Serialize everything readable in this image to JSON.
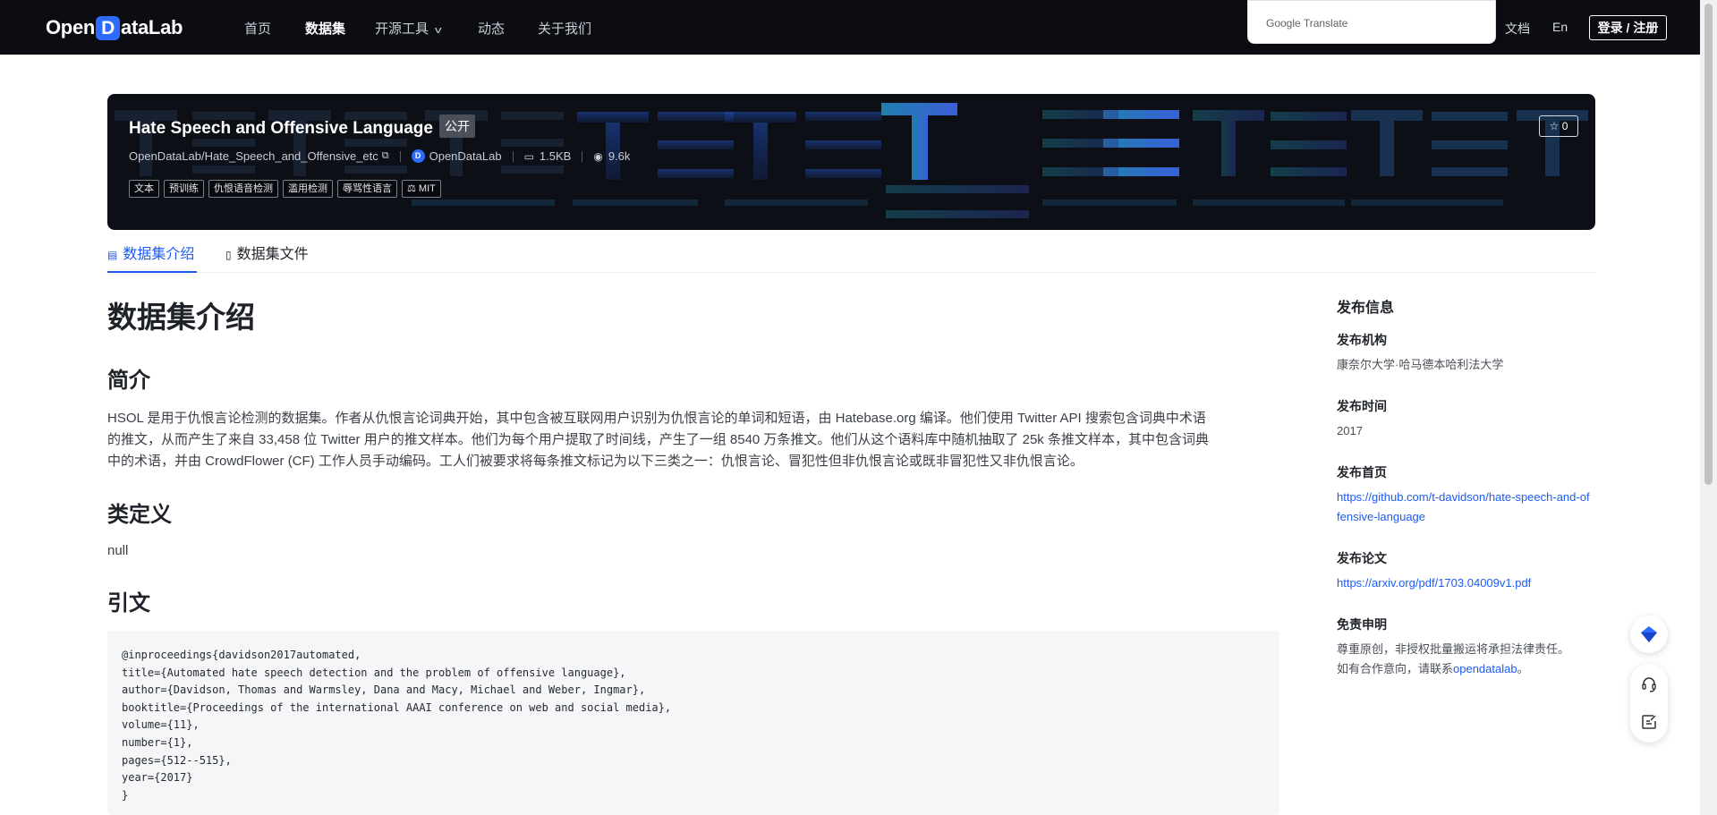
{
  "navbar": {
    "logo_left": "Open",
    "logo_mark": "D",
    "logo_right": "ataLab",
    "items": [
      "首页",
      "数据集",
      "开源工具",
      "动态",
      "关于我们"
    ],
    "google_translate": "Google Translate",
    "docs": "文档",
    "lang": "En",
    "login": "登录 / 注册"
  },
  "hero": {
    "title": "Hate Speech and Offensive Language",
    "visibility": "公开",
    "repo": "OpenDataLab/Hate_Speech_and_Offensive_etc",
    "org": "OpenDataLab",
    "size": "1.5KB",
    "views": "9.6k",
    "tags": [
      "文本",
      "预训练",
      "仇恨语音检测",
      "滥用检测",
      "辱骂性语言"
    ],
    "license": "MIT",
    "stars": "0"
  },
  "tabs": [
    "数据集介绍",
    "数据集文件"
  ],
  "content": {
    "h1": "数据集介绍",
    "intro_heading": "简介",
    "intro_lines": [
      "HSOL 是用于仇恨言论检测的数据集。作者从仇恨言论词典开始，其中包含被互联网用户识别为仇恨言论的单词和短语，由 Hatebase.org 编译。他们使用 Twitter API 搜索包含词典中术语",
      "的推文，从而产生了来自 33,458 位 Twitter 用户的推文样本。他们为每个用户提取了时间线，产生了一组 8540 万条推文。他们从这个语料库中随机抽取了 25k 条推文样本，其中包含词典",
      "中的术语，并由 CrowdFlower (CF) 工作人员手动编码。工人们被要求将每条推文标记为以下三类之一：仇恨言论、冒犯性但非仇恨言论或既非冒犯性又非仇恨言论。"
    ],
    "class_heading": "类定义",
    "class_value": "null",
    "citation_heading": "引文",
    "citation": [
      "@inproceedings{davidson2017automated,",
      "title={Automated hate speech detection and the problem of offensive language},",
      "author={Davidson, Thomas and Warmsley, Dana and Macy, Michael and Weber, Ingmar},",
      "booktitle={Proceedings of the international AAAI conference on web and social media},",
      "volume={11},",
      "number={1},",
      "pages={512--515},",
      "year={2017}",
      "}"
    ]
  },
  "sidebar": {
    "title": "发布信息",
    "org_label": "发布机构",
    "org_value": "康奈尔大学·哈马德本哈利法大学",
    "time_label": "发布时间",
    "time_value": "2017",
    "home_label": "发布首页",
    "home_link": "https://github.com/t-davidson/hate-speech-and-offensive-language",
    "paper_label": "发布论文",
    "paper_link": "https://arxiv.org/pdf/1703.04009v1.pdf",
    "disclaimer_label": "免责申明",
    "disclaimer_line1": "尊重原创，非授权批量搬运将承担法律责任。",
    "disclaimer_line2_prefix": "如有合作意向，请联系",
    "disclaimer_link": "opendatalab",
    "disclaimer_line2_suffix": "。"
  },
  "colors": {
    "accent": "#1d5bf4",
    "navbar_bg": "#0b0d13",
    "hero_bg": "#0c0f16"
  },
  "icons": [
    "star-icon",
    "copy-icon",
    "disk-icon",
    "eye-icon",
    "scale-icon",
    "doc-icon",
    "file-icon",
    "diamond-icon",
    "headset-icon",
    "feedback-icon",
    "chevron-down-icon"
  ]
}
